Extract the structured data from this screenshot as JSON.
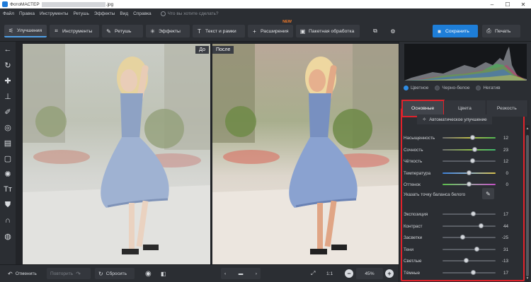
{
  "titlebar": {
    "title": "ФотоМАСТЕР",
    "file_name": ".jpg"
  },
  "menu": {
    "items": [
      "Файл",
      "Правка",
      "Инструменты",
      "Ретушь",
      "Эффекты",
      "Вид",
      "Справка"
    ],
    "search_placeholder": "Что вы хотите сделать?"
  },
  "toolbar": {
    "enhance": "Улучшения",
    "tools": "Инструменты",
    "retouch": "Ретушь",
    "effects": "Эффекты",
    "text": "Текст и рамки",
    "extensions": "Расширения",
    "new_badge": "NEW",
    "batch": "Пакетная обработка",
    "save": "Сохранить",
    "print": "Печать"
  },
  "photos": {
    "before_label": "До",
    "after_label": "После"
  },
  "panel": {
    "radios": [
      {
        "label": "Цветное",
        "selected": true
      },
      {
        "label": "Черно-белое",
        "selected": false
      },
      {
        "label": "Негатив",
        "selected": false
      }
    ],
    "tabs": [
      "Основные",
      "Цвета",
      "Резкость"
    ],
    "auto_button": "Автоматическое улучшение",
    "white_balance": "Указать точку баланса белого",
    "sliders": [
      {
        "label": "Насыщенность",
        "value": "12",
        "level": 0.56,
        "track": "linear-gradient(90deg,#6f6f6f,#b8b84a,#51b851)"
      },
      {
        "label": "Сочность",
        "value": "23",
        "level": 0.61,
        "track": "linear-gradient(90deg,#707070,#8ab84a,#3fb86c)"
      },
      {
        "label": "Чёткость",
        "value": "12",
        "level": 0.56,
        "track": "#5a5e65"
      },
      {
        "label": "Температура",
        "value": "0",
        "level": 0.5,
        "track": "linear-gradient(90deg,#3d7fd6,#8fb0c8,#d8c04a)"
      },
      {
        "label": "Оттенок",
        "value": "0",
        "level": 0.5,
        "track": "linear-gradient(90deg,#5bbf4a,#9aa0a0,#c44fc4)"
      },
      {
        "label": "Экспозиция",
        "value": "17",
        "level": 0.58,
        "track": "#5a5e65"
      },
      {
        "label": "Контраст",
        "value": "44",
        "level": 0.72,
        "track": "#5a5e65"
      },
      {
        "label": "Засветки",
        "value": "-25",
        "level": 0.38,
        "track": "#5a5e65"
      },
      {
        "label": "Тени",
        "value": "31",
        "level": 0.65,
        "track": "#5a5e65"
      },
      {
        "label": "Светлые",
        "value": "-13",
        "level": 0.44,
        "track": "#5a5e65"
      },
      {
        "label": "Тёмные",
        "value": "17",
        "level": 0.58,
        "track": "#5a5e65"
      }
    ]
  },
  "bottom": {
    "undo": "Отменить",
    "redo": "Повторить",
    "reset": "Сбросить",
    "ratio": "1:1",
    "zoom": "45%"
  },
  "colors": {
    "accent": "#1e7ed8",
    "highlight": "#e1222b"
  }
}
